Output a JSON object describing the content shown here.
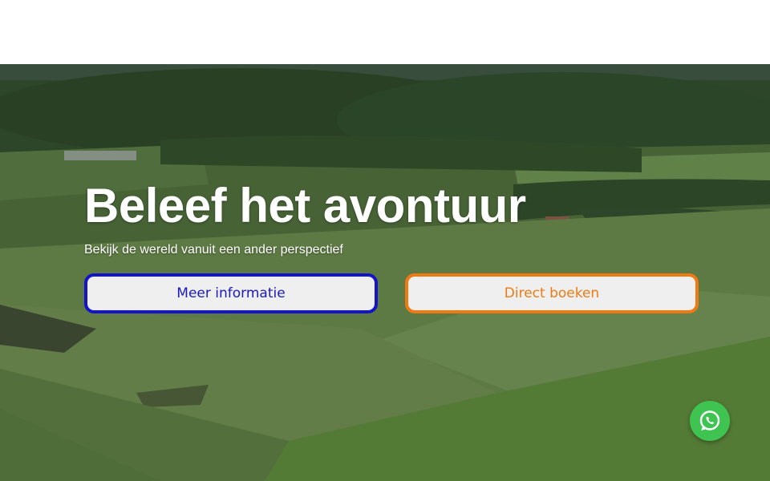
{
  "hero": {
    "title": "Beleef het avontuur",
    "subtitle": "Bekijk de wereld vanuit een ander perspectief"
  },
  "buttons": {
    "info_label": "Meer informatie",
    "book_label": "Direct boeken"
  },
  "floating": {
    "icon": "whatsapp-icon"
  },
  "colors": {
    "info_border": "#1414c8",
    "book_border": "#ef7a12",
    "whatsapp_green": "#3fc452"
  }
}
